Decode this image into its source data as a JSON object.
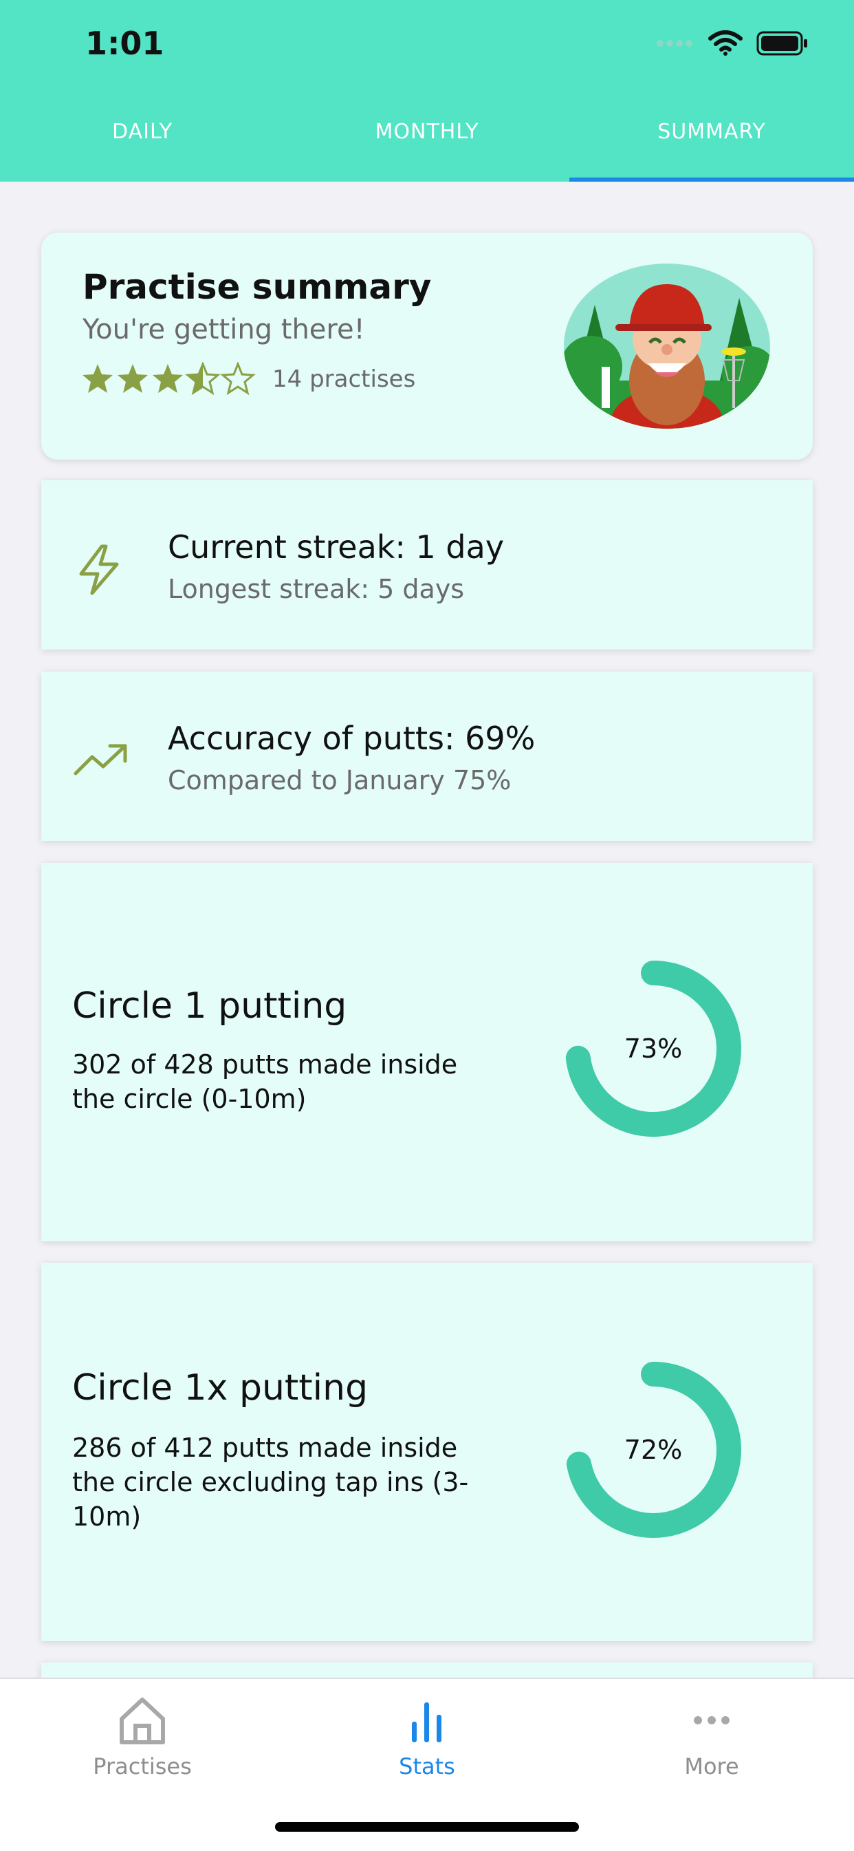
{
  "status_bar": {
    "time": "1:01"
  },
  "tabs": [
    {
      "label": "DAILY",
      "active": false
    },
    {
      "label": "MONTHLY",
      "active": false
    },
    {
      "label": "SUMMARY",
      "active": true
    }
  ],
  "summary_card": {
    "title": "Practise summary",
    "subtitle": "You're getting there!",
    "rating": 3.5,
    "rating_max": 5,
    "practise_count": "14 practises"
  },
  "streak_card": {
    "icon": "lightning-icon",
    "current": "Current streak: 1 day",
    "longest": "Longest streak: 5 days"
  },
  "accuracy_card": {
    "icon": "trending-up-icon",
    "accuracy": "Accuracy of putts: 69%",
    "comparison": "Compared to January 75%"
  },
  "circle_cards": [
    {
      "title": "Circle 1 putting",
      "description": "302 of 428 putts made inside the circle (0-10m)",
      "percent_label": "73%",
      "percent": 73
    },
    {
      "title": "Circle 1x putting",
      "description": "286 of 412 putts made inside the circle excluding tap ins (3-10m)",
      "percent_label": "72%",
      "percent": 72
    }
  ],
  "bottom_nav": [
    {
      "label": "Practises",
      "icon": "home-icon",
      "active": false
    },
    {
      "label": "Stats",
      "icon": "bar-chart-icon",
      "active": true
    },
    {
      "label": "More",
      "icon": "more-dots-icon",
      "active": false
    }
  ],
  "colors": {
    "header": "#52e4c4",
    "accent_blue": "#1b88e8",
    "card_bg": "#e4fdf9",
    "donut": "#3fcaa8",
    "star": "#8aa044"
  }
}
